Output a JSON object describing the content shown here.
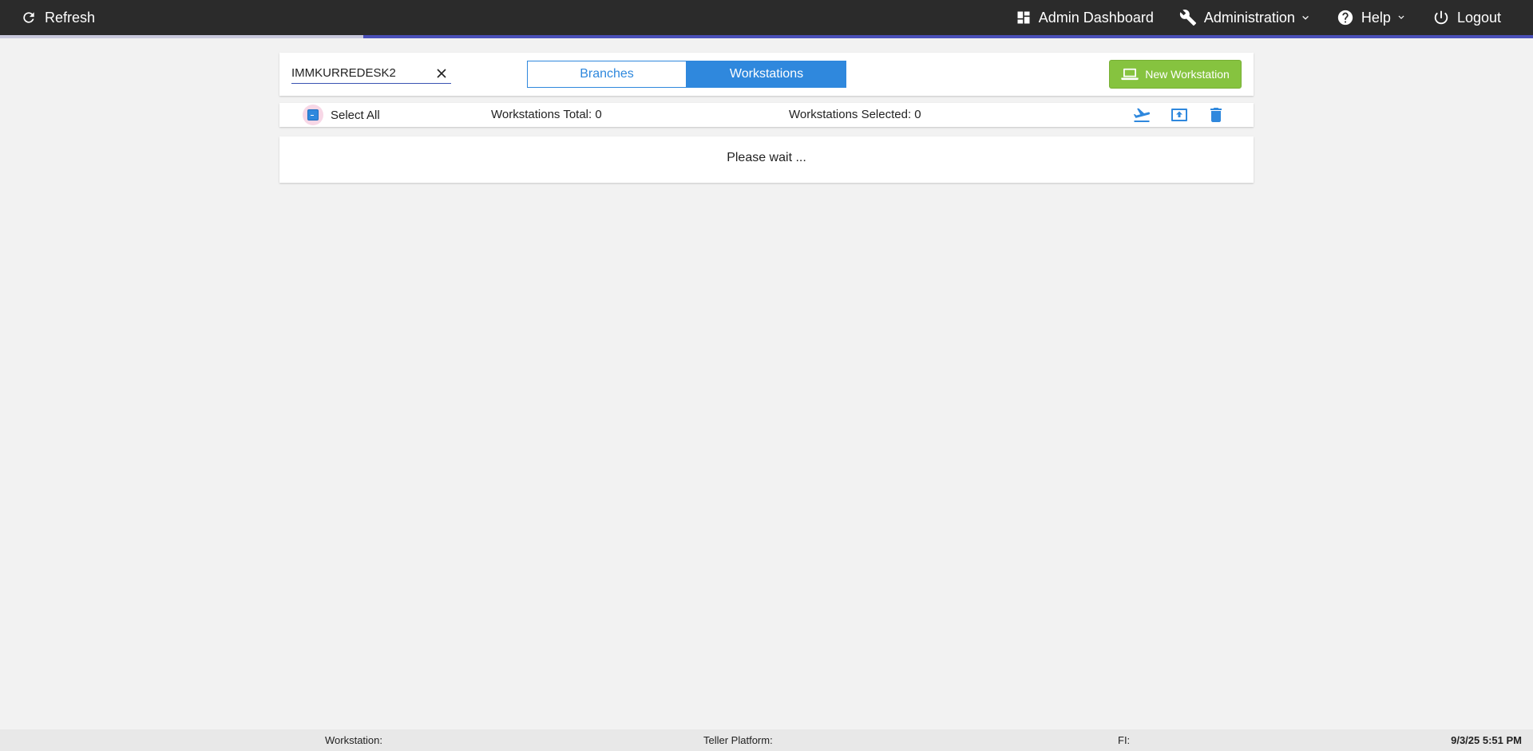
{
  "topbar": {
    "refresh_label": "Refresh",
    "admin_dashboard_label": "Admin Dashboard",
    "administration_label": "Administration",
    "help_label": "Help",
    "logout_label": "Logout"
  },
  "progress": {
    "fraction": 0.763
  },
  "filter": {
    "search_value": "IMMKURREDESK2",
    "tabs": [
      {
        "label": "Branches",
        "active": false
      },
      {
        "label": "Workstations",
        "active": true
      }
    ],
    "new_workstation_label": "New Workstation"
  },
  "selection": {
    "select_all_label": "Select All",
    "total_text": "Workstations Total: 0",
    "selected_text": "Workstations Selected: 0"
  },
  "status": {
    "message": "Please wait ..."
  },
  "footer": {
    "workstation_label": "Workstation:",
    "teller_platform_label": "Teller Platform:",
    "fi_label": "FI:",
    "datetime": "9/3/25 5:51 PM"
  },
  "colors": {
    "topbar_bg": "#2b2b2b",
    "accent_blue": "#2f88dd",
    "progress_indigo": "#4a4fb8",
    "new_button_green": "#86c33f"
  },
  "icons": {
    "refresh": "refresh-icon",
    "dashboard": "dashboard-grid-icon",
    "administration": "wrench-icon",
    "help": "question-circle-icon",
    "logout": "power-icon",
    "new_workstation": "laptop-icon",
    "depart": "airplane-takeoff-icon",
    "upload": "upload-box-icon",
    "delete": "trash-icon",
    "clear": "close-icon"
  }
}
